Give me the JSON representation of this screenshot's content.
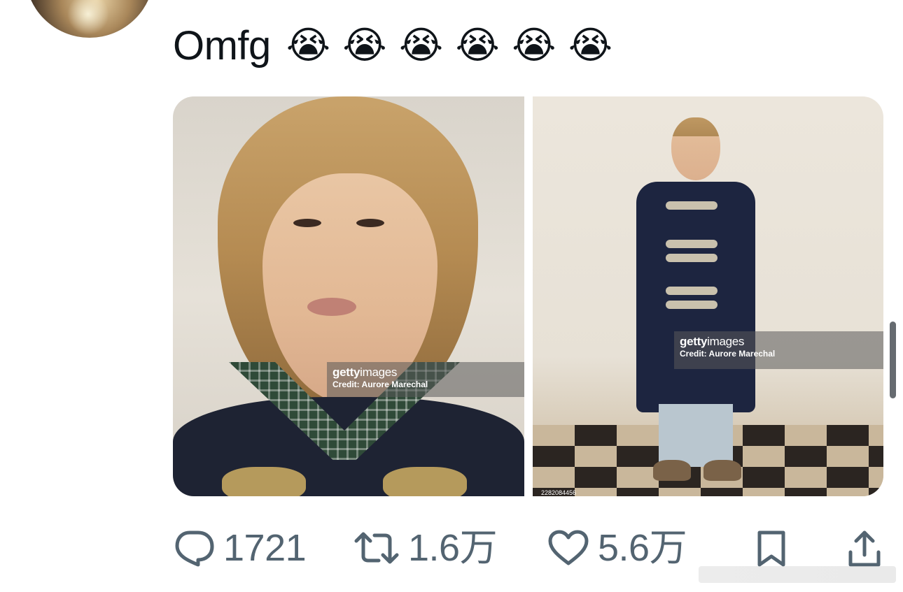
{
  "tweet": {
    "text": "Omfg",
    "emojis": [
      "😭",
      "😭",
      "😭",
      "😭",
      "😭",
      "😭"
    ]
  },
  "media": {
    "left": {
      "watermark_brand_bold": "getty",
      "watermark_brand_thin": "images",
      "watermark_credit": "Credit: Aurore Marechal"
    },
    "right": {
      "watermark_brand_bold": "getty",
      "watermark_brand_thin": "images",
      "watermark_credit": "Credit: Aurore Marechal",
      "stock_id": "2282084456"
    }
  },
  "actions": {
    "reply": {
      "icon": "reply-icon",
      "count": "1721"
    },
    "retweet": {
      "icon": "retweet-icon",
      "count": "1.6万"
    },
    "like": {
      "icon": "heart-icon",
      "count": "5.6万"
    },
    "bookmark": {
      "icon": "bookmark-icon"
    },
    "share": {
      "icon": "share-icon"
    }
  },
  "colors": {
    "text": "#0f1419",
    "icon_gray": "#536471",
    "background": "#ffffff"
  }
}
